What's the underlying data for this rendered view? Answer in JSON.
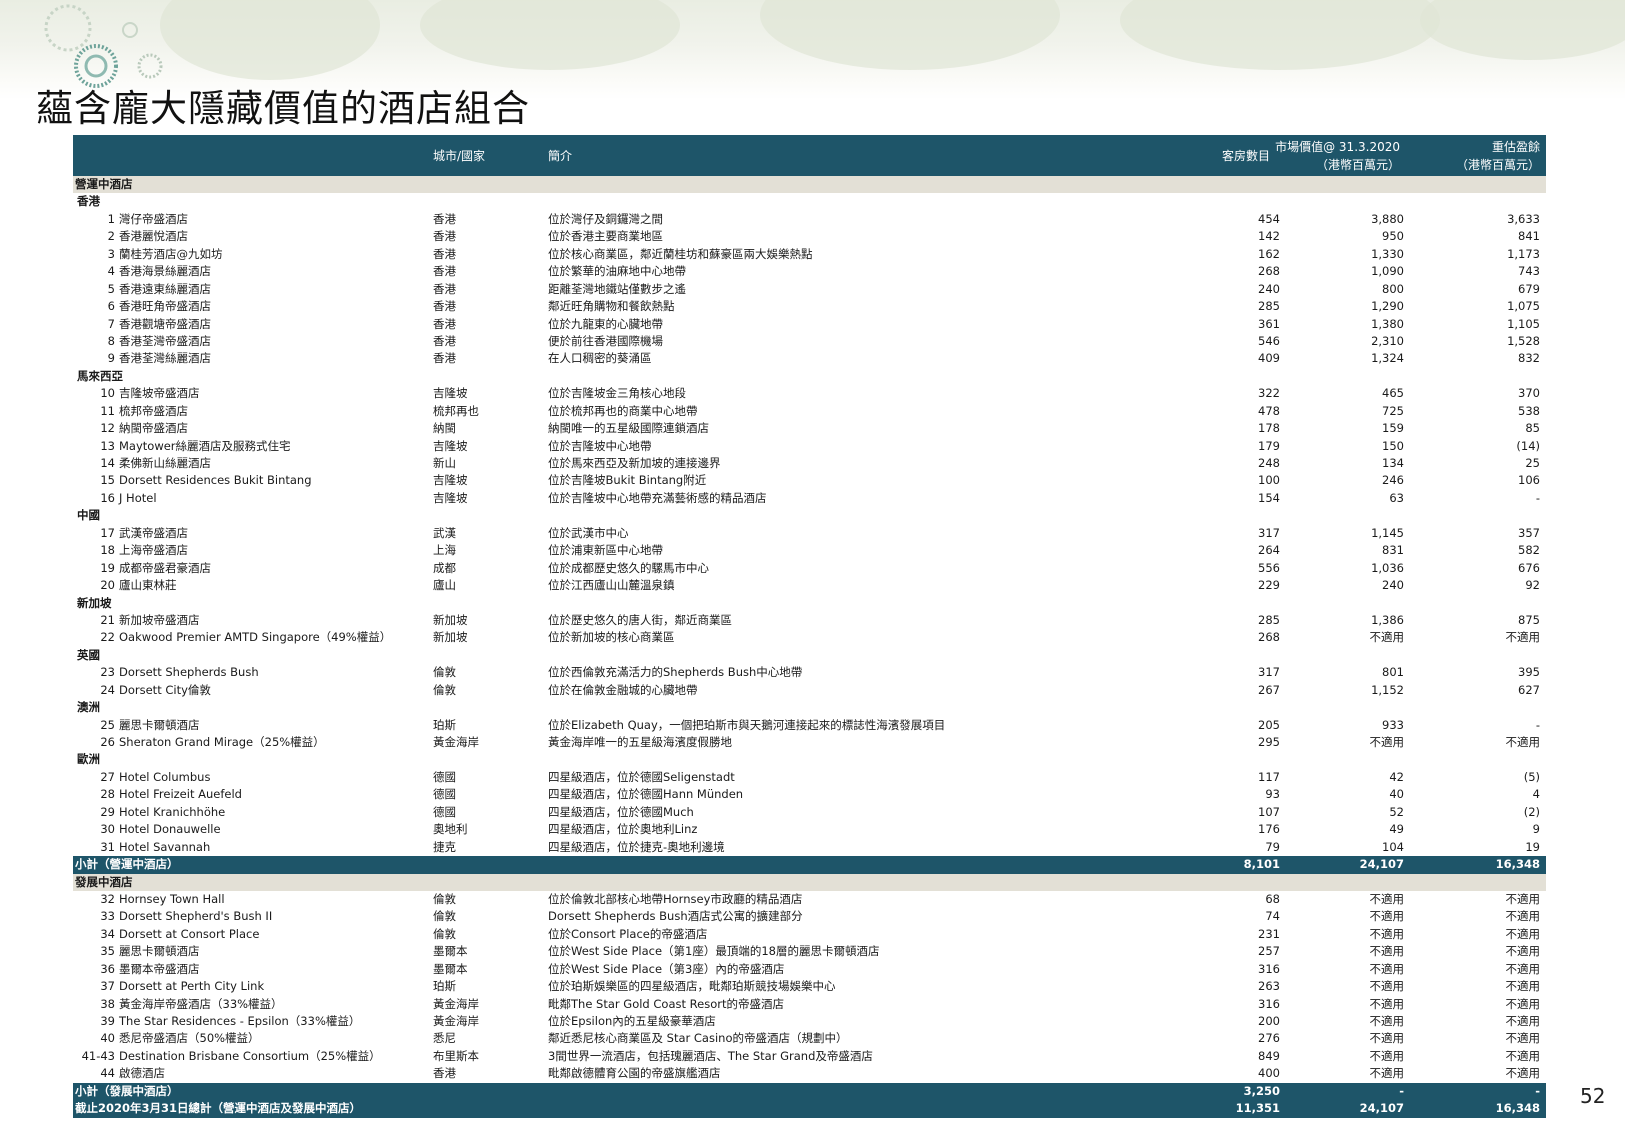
{
  "title": "蘊含龐大隱藏價值的酒店組合",
  "page_number": "52",
  "colors": {
    "header_bg": "#1e5569",
    "section_bg": "#e3e0d6"
  },
  "columns": {
    "city": "城市/國家",
    "desc": "簡介",
    "rooms": "客房數目",
    "market_value_line1": "市場價值@ 31.3.2020",
    "market_value_line2": "（港幣百萬元）",
    "revaluation_line1": "重估盈餘",
    "revaluation_line2": "（港幣百萬元）"
  },
  "rows": [
    {
      "type": "section",
      "label": "營運中酒店"
    },
    {
      "type": "region",
      "label": "香港"
    },
    {
      "type": "hotel",
      "num": "1",
      "name": "灣仔帝盛酒店",
      "city": "香港",
      "desc": "位於灣仔及銅鑼灣之間",
      "rooms": "454",
      "mv": "3,880",
      "rev": "3,633"
    },
    {
      "type": "hotel",
      "num": "2",
      "name": "香港麗悅酒店",
      "city": "香港",
      "desc": "位於香港主要商業地區",
      "rooms": "142",
      "mv": "950",
      "rev": "841"
    },
    {
      "type": "hotel",
      "num": "3",
      "name": "蘭桂芳酒店@九如坊",
      "city": "香港",
      "desc": "位於核心商業區，鄰近蘭桂坊和蘇豪區兩大娛樂熱點",
      "rooms": "162",
      "mv": "1,330",
      "rev": "1,173"
    },
    {
      "type": "hotel",
      "num": "4",
      "name": "香港海景絲麗酒店",
      "city": "香港",
      "desc": "位於繁華的油麻地中心地帶",
      "rooms": "268",
      "mv": "1,090",
      "rev": "743"
    },
    {
      "type": "hotel",
      "num": "5",
      "name": "香港遠東絲麗酒店",
      "city": "香港",
      "desc": "距離荃灣地鐵站僅數步之遙",
      "rooms": "240",
      "mv": "800",
      "rev": "679"
    },
    {
      "type": "hotel",
      "num": "6",
      "name": "香港旺角帝盛酒店",
      "city": "香港",
      "desc": "鄰近旺角購物和餐飲熱點",
      "rooms": "285",
      "mv": "1,290",
      "rev": "1,075"
    },
    {
      "type": "hotel",
      "num": "7",
      "name": "香港觀塘帝盛酒店",
      "city": "香港",
      "desc": "位於九龍東的心臟地帶",
      "rooms": "361",
      "mv": "1,380",
      "rev": "1,105"
    },
    {
      "type": "hotel",
      "num": "8",
      "name": "香港荃灣帝盛酒店",
      "city": "香港",
      "desc": "便於前往香港國際機場",
      "rooms": "546",
      "mv": "2,310",
      "rev": "1,528"
    },
    {
      "type": "hotel",
      "num": "9",
      "name": "香港荃灣絲麗酒店",
      "city": "香港",
      "desc": "在人口稠密的葵涌區",
      "rooms": "409",
      "mv": "1,324",
      "rev": "832"
    },
    {
      "type": "region",
      "label": "馬來西亞"
    },
    {
      "type": "hotel",
      "num": "10",
      "name": "吉隆坡帝盛酒店",
      "city": "吉隆坡",
      "desc": "位於吉隆坡金三角核心地段",
      "rooms": "322",
      "mv": "465",
      "rev": "370"
    },
    {
      "type": "hotel",
      "num": "11",
      "name": "梳邦帝盛酒店",
      "city": "梳邦再也",
      "desc": "位於梳邦再也的商業中心地帶",
      "rooms": "478",
      "mv": "725",
      "rev": "538"
    },
    {
      "type": "hotel",
      "num": "12",
      "name": "納閩帝盛酒店",
      "city": "納閩",
      "desc": "納閩唯一的五星級國際連鎖酒店",
      "rooms": "178",
      "mv": "159",
      "rev": "85"
    },
    {
      "type": "hotel",
      "num": "13",
      "name": "Maytower絲麗酒店及服務式住宅",
      "city": "吉隆坡",
      "desc": "位於吉隆坡中心地帶",
      "rooms": "179",
      "mv": "150",
      "rev": "(14)"
    },
    {
      "type": "hotel",
      "num": "14",
      "name": "柔佛新山絲麗酒店",
      "city": "新山",
      "desc": "位於馬來西亞及新加坡的連接邊界",
      "rooms": "248",
      "mv": "134",
      "rev": "25"
    },
    {
      "type": "hotel",
      "num": "15",
      "name": "Dorsett Residences Bukit Bintang",
      "city": "吉隆坡",
      "desc": "位於吉隆坡Bukit Bintang附近",
      "rooms": "100",
      "mv": "246",
      "rev": "106"
    },
    {
      "type": "hotel",
      "num": "16",
      "name": "J Hotel",
      "city": "吉隆坡",
      "desc": "位於吉隆坡中心地帶充滿藝術感的精品酒店",
      "rooms": "154",
      "mv": "63",
      "rev": "-"
    },
    {
      "type": "region",
      "label": "中國"
    },
    {
      "type": "hotel",
      "num": "17",
      "name": "武漢帝盛酒店",
      "city": "武漢",
      "desc": "位於武漢市中心",
      "rooms": "317",
      "mv": "1,145",
      "rev": "357"
    },
    {
      "type": "hotel",
      "num": "18",
      "name": "上海帝盛酒店",
      "city": "上海",
      "desc": "位於浦東新區中心地帶",
      "rooms": "264",
      "mv": "831",
      "rev": "582"
    },
    {
      "type": "hotel",
      "num": "19",
      "name": "成都帝盛君豪酒店",
      "city": "成都",
      "desc": "位於成都歷史悠久的騾馬市中心",
      "rooms": "556",
      "mv": "1,036",
      "rev": "676"
    },
    {
      "type": "hotel",
      "num": "20",
      "name": "廬山東林莊",
      "city": "廬山",
      "desc": "位於江西廬山山麓溫泉鎮",
      "rooms": "229",
      "mv": "240",
      "rev": "92"
    },
    {
      "type": "region",
      "label": "新加坡"
    },
    {
      "type": "hotel",
      "num": "21",
      "name": "新加坡帝盛酒店",
      "city": "新加坡",
      "desc": "位於歷史悠久的唐人街，鄰近商業區",
      "rooms": "285",
      "mv": "1,386",
      "rev": "875"
    },
    {
      "type": "hotel",
      "num": "22",
      "name": "Oakwood Premier AMTD Singapore（49%權益）",
      "city": "新加坡",
      "desc": "位於新加坡的核心商業區",
      "rooms": "268",
      "mv": "不適用",
      "rev": "不適用"
    },
    {
      "type": "region",
      "label": "英國"
    },
    {
      "type": "hotel",
      "num": "23",
      "name": "Dorsett Shepherds Bush",
      "city": "倫敦",
      "desc": "位於西倫敦充滿活力的Shepherds Bush中心地帶",
      "rooms": "317",
      "mv": "801",
      "rev": "395"
    },
    {
      "type": "hotel",
      "num": "24",
      "name": "Dorsett City倫敦",
      "city": "倫敦",
      "desc": "位於在倫敦金融城的心臟地帶",
      "rooms": "267",
      "mv": "1,152",
      "rev": "627"
    },
    {
      "type": "region",
      "label": "澳洲"
    },
    {
      "type": "hotel",
      "num": "25",
      "name": "麗思卡爾頓酒店",
      "city": "珀斯",
      "desc": "位於Elizabeth Quay，一個把珀斯市與天鵝河連接起來的標誌性海濱發展項目",
      "rooms": "205",
      "mv": "933",
      "rev": "-"
    },
    {
      "type": "hotel",
      "num": "26",
      "name": "Sheraton Grand Mirage（25%權益）",
      "city": "黃金海岸",
      "desc": "黃金海岸唯一的五星級海濱度假勝地",
      "rooms": "295",
      "mv": "不適用",
      "rev": "不適用"
    },
    {
      "type": "region",
      "label": "歐洲"
    },
    {
      "type": "hotel",
      "num": "27",
      "name": "Hotel Columbus",
      "city": "德國",
      "desc": "四星級酒店，位於德國Seligenstadt",
      "rooms": "117",
      "mv": "42",
      "rev": "(5)"
    },
    {
      "type": "hotel",
      "num": "28",
      "name": "Hotel Freizeit Auefeld",
      "city": "德國",
      "desc": "四星級酒店，位於德國Hann Münden",
      "rooms": "93",
      "mv": "40",
      "rev": "4"
    },
    {
      "type": "hotel",
      "num": "29",
      "name": "Hotel Kranichhöhe",
      "city": "德國",
      "desc": "四星級酒店，位於德國Much",
      "rooms": "107",
      "mv": "52",
      "rev": "(2)"
    },
    {
      "type": "hotel",
      "num": "30",
      "name": "Hotel Donauwelle",
      "city": "奧地利",
      "desc": "四星級酒店，位於奧地利Linz",
      "rooms": "176",
      "mv": "49",
      "rev": "9"
    },
    {
      "type": "hotel",
      "num": "31",
      "name": "Hotel Savannah",
      "city": "捷克",
      "desc": "四星級酒店，位於捷克-奧地利邊境",
      "rooms": "79",
      "mv": "104",
      "rev": "19"
    },
    {
      "type": "subtotal",
      "label": "小計（營運中酒店）",
      "rooms": "8,101",
      "mv": "24,107",
      "rev": "16,348"
    },
    {
      "type": "section",
      "label": "發展中酒店"
    },
    {
      "type": "hotel",
      "num": "32",
      "name": "Hornsey Town Hall",
      "city": "倫敦",
      "desc": "位於倫敦北部核心地帶Hornsey市政廳的精品酒店",
      "rooms": "68",
      "mv": "不適用",
      "rev": "不適用"
    },
    {
      "type": "hotel",
      "num": "33",
      "name": "Dorsett Shepherd's Bush II",
      "city": "倫敦",
      "desc": "Dorsett Shepherds Bush酒店式公寓的擴建部分",
      "rooms": "74",
      "mv": "不適用",
      "rev": "不適用"
    },
    {
      "type": "hotel",
      "num": "34",
      "name": "Dorsett at Consort Place",
      "city": "倫敦",
      "desc": "位於Consort Place的帝盛酒店",
      "rooms": "231",
      "mv": "不適用",
      "rev": "不適用"
    },
    {
      "type": "hotel",
      "num": "35",
      "name": "麗思卡爾頓酒店",
      "city": "墨爾本",
      "desc": "位於West Side Place（第1座）最頂端的18層的麗思卡爾頓酒店",
      "rooms": "257",
      "mv": "不適用",
      "rev": "不適用"
    },
    {
      "type": "hotel",
      "num": "36",
      "name": "墨爾本帝盛酒店",
      "city": "墨爾本",
      "desc": "位於West Side Place（第3座）內的帝盛酒店",
      "rooms": "316",
      "mv": "不適用",
      "rev": "不適用"
    },
    {
      "type": "hotel",
      "num": "37",
      "name": "Dorsett at Perth City Link",
      "city": "珀斯",
      "desc": "位於珀斯娛樂區的四星級酒店，毗鄰珀斯競技場娛樂中心",
      "rooms": "263",
      "mv": "不適用",
      "rev": "不適用"
    },
    {
      "type": "hotel",
      "num": "38",
      "name": "黃金海岸帝盛酒店（33%權益）",
      "city": "黃金海岸",
      "desc": "毗鄰The Star Gold Coast Resort的帝盛酒店",
      "rooms": "316",
      "mv": "不適用",
      "rev": "不適用"
    },
    {
      "type": "hotel",
      "num": "39",
      "name": "The Star Residences - Epsilon（33%權益）",
      "city": "黃金海岸",
      "desc": "位於Epsilon內的五星級豪華酒店",
      "rooms": "200",
      "mv": "不適用",
      "rev": "不適用"
    },
    {
      "type": "hotel",
      "num": "40",
      "name": "悉尼帝盛酒店（50%權益）",
      "city": "悉尼",
      "desc": "鄰近悉尼核心商業區及 Star Casino的帝盛酒店（規劃中）",
      "rooms": "276",
      "mv": "不適用",
      "rev": "不適用"
    },
    {
      "type": "hotel",
      "num": "41-43",
      "name": "Destination Brisbane Consortium（25%權益）",
      "city": "布里斯本",
      "desc": "3間世界一流酒店，包括瑰麗酒店、The Star Grand及帝盛酒店",
      "rooms": "849",
      "mv": "不適用",
      "rev": "不適用"
    },
    {
      "type": "hotel",
      "num": "44",
      "name": "啟德酒店",
      "city": "香港",
      "desc": "毗鄰啟德體育公園的帝盛旗艦酒店",
      "rooms": "400",
      "mv": "不適用",
      "rev": "不適用"
    },
    {
      "type": "subtotal",
      "label": "小計（發展中酒店）",
      "rooms": "3,250",
      "mv": "-",
      "rev": "-"
    },
    {
      "type": "subtotal",
      "label": "截止2020年3月31日總計（營運中酒店及發展中酒店）",
      "rooms": "11,351",
      "mv": "24,107",
      "rev": "16,348"
    }
  ]
}
